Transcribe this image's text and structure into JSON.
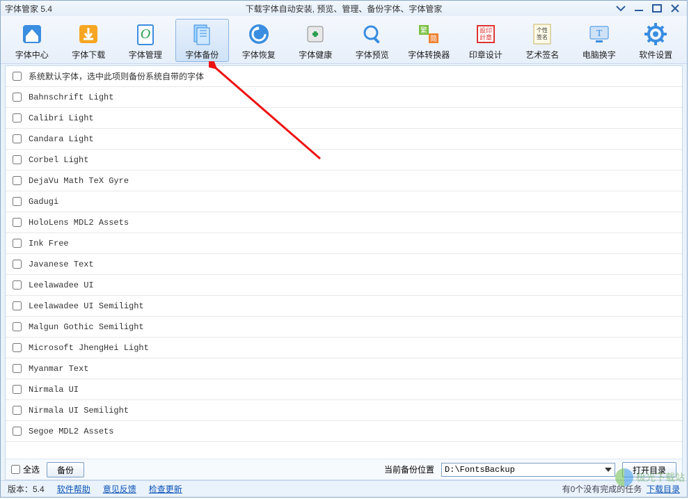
{
  "title": {
    "app": "字体管家 5.4",
    "subtitle": "下载字体自动安装, 预览、管理、备份字体、字体管家"
  },
  "toolbar": [
    {
      "id": "font-center",
      "label": "字体中心",
      "icon": "home"
    },
    {
      "id": "font-download",
      "label": "字体下载",
      "icon": "download"
    },
    {
      "id": "font-manage",
      "label": "字体管理",
      "icon": "manage"
    },
    {
      "id": "font-backup",
      "label": "字体备份",
      "icon": "backup",
      "active": true
    },
    {
      "id": "font-restore",
      "label": "字体恢复",
      "icon": "restore"
    },
    {
      "id": "font-health",
      "label": "字体健康",
      "icon": "health"
    },
    {
      "id": "font-preview",
      "label": "字体预览",
      "icon": "preview"
    },
    {
      "id": "font-convert",
      "label": "字体转换器",
      "icon": "convert"
    },
    {
      "id": "seal-design",
      "label": "印章设计",
      "icon": "seal"
    },
    {
      "id": "art-sign",
      "label": "艺术签名",
      "icon": "sign"
    },
    {
      "id": "pc-font",
      "label": "电脑换字",
      "icon": "pcfont"
    },
    {
      "id": "settings",
      "label": "软件设置",
      "icon": "gear"
    }
  ],
  "fonts": [
    "系统默认字体，选中此项则备份系统自带的字体",
    "Bahnschrift Light",
    "Calibri Light",
    "Candara Light",
    "Corbel Light",
    "DejaVu Math TeX Gyre",
    "Gadugi",
    "HoloLens MDL2 Assets",
    "Ink Free",
    "Javanese Text",
    "Leelawadee UI",
    "Leelawadee UI Semilight",
    "Malgun Gothic Semilight",
    "Microsoft JhengHei Light",
    "Myanmar Text",
    "Nirmala UI",
    "Nirmala UI Semilight",
    "Segoe MDL2 Assets"
  ],
  "bottom": {
    "select_all": "全选",
    "backup_btn": "备份",
    "path_label": "当前备份位置",
    "path_value": "D:\\FontsBackup",
    "open_dir": "打开目录"
  },
  "status": {
    "version": "版本：5.4",
    "help": "软件帮助",
    "feedback": "意见反馈",
    "update": "检查更新",
    "right": "有0个没有完成的任务",
    "download_dir": "下载目录"
  },
  "watermark": "极光下载站"
}
